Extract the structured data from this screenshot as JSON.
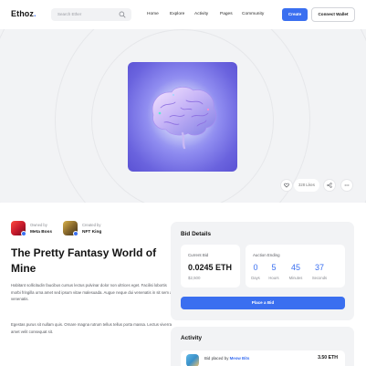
{
  "header": {
    "logo_main": "Ethoz",
    "logo_dot": ".",
    "search_placeholder": "Search Ether",
    "nav": [
      "Home",
      "Explore",
      "Activity",
      "Pages",
      "Community"
    ],
    "create_label": "Create",
    "connect_label": "Connect Wallet"
  },
  "hero": {
    "likes": "328 Likes"
  },
  "item": {
    "owner_role": "Owned by",
    "owner_name": "Meta Boss",
    "creator_role": "Created by",
    "creator_name": "NFT King",
    "title": "The Pretty Fantasy World of Mine",
    "paragraphs": [
      "Habitant sollicitudin faucibus cursus lectus pulvinar dolor non ultrices eget. Facilisi lobortis morbi fringilla urna amet sed ipsum vitae malesuada. Augue neque dui venenatis in sit sem a venenatis.",
      "Egestas purus sit nullam quis. Ornare magna rutrum tellus tellus porta massa. Lectus viverra amet velit consequat sit."
    ]
  },
  "bid": {
    "heading": "Bid Details",
    "current_label": "Current Bid",
    "current_value": "0.0245 ETH",
    "current_usd": "$2,500",
    "ending_label": "Auction Ending",
    "countdown": [
      {
        "value": "0",
        "unit": "Days"
      },
      {
        "value": "5",
        "unit": "Hours"
      },
      {
        "value": "45",
        "unit": "Minutes"
      },
      {
        "value": "37",
        "unit": "Seconds"
      }
    ],
    "place_bid_label": "Place a Bid"
  },
  "activity": {
    "heading": "Activity",
    "row": {
      "prefix": "Bid placed",
      "by": "by",
      "who": "Meow Bits",
      "amount": "3.50 ETH"
    }
  },
  "colors": {
    "accent": "#3a6ff0",
    "panel": "#f2f3f5"
  }
}
